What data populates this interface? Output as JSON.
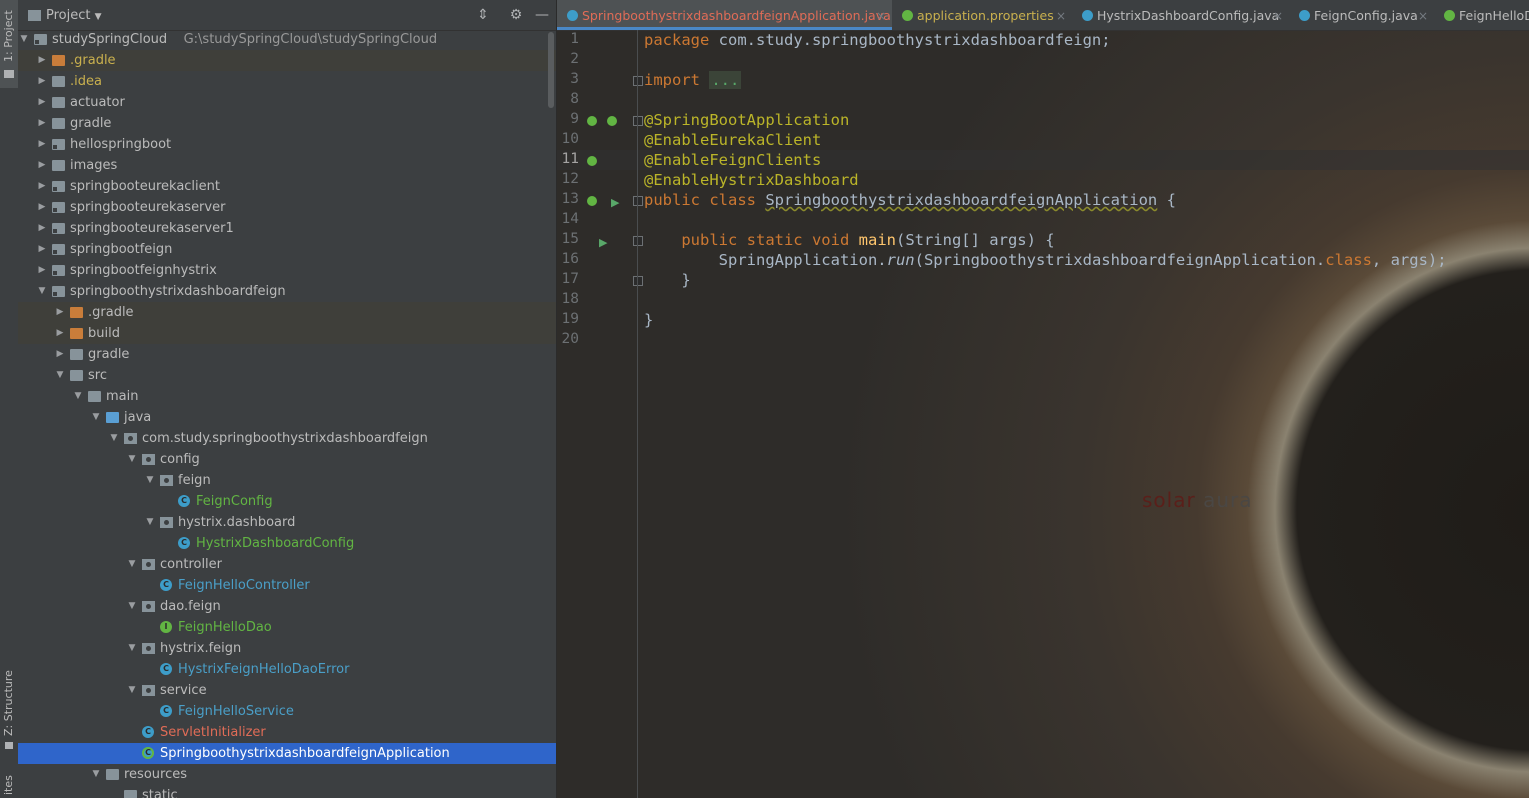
{
  "left_stripe": {
    "project_tab": "1: Project",
    "structure_tab": "Z: Structure",
    "favorites_tab": "ites"
  },
  "project_panel": {
    "title": "Project"
  },
  "tree": [
    {
      "label": "studySpringCloud",
      "path": "G:\\studySpringCloud\\studySpringCloud",
      "indent": 0,
      "arrow": "open",
      "icon": "module",
      "color": ""
    },
    {
      "label": ".gradle",
      "indent": 1,
      "arrow": "closed",
      "icon": "folder-orange",
      "color": "yellow",
      "hl": true
    },
    {
      "label": ".idea",
      "indent": 1,
      "arrow": "closed",
      "icon": "folder",
      "color": "yellow"
    },
    {
      "label": "actuator",
      "indent": 1,
      "arrow": "closed",
      "icon": "folder",
      "color": ""
    },
    {
      "label": "gradle",
      "indent": 1,
      "arrow": "closed",
      "icon": "folder",
      "color": ""
    },
    {
      "label": "hellospringboot",
      "indent": 1,
      "arrow": "closed",
      "icon": "module",
      "color": ""
    },
    {
      "label": "images",
      "indent": 1,
      "arrow": "closed",
      "icon": "folder",
      "color": ""
    },
    {
      "label": "springbooteurekaclient",
      "indent": 1,
      "arrow": "closed",
      "icon": "module",
      "color": ""
    },
    {
      "label": "springbooteurekaserver",
      "indent": 1,
      "arrow": "closed",
      "icon": "module",
      "color": ""
    },
    {
      "label": "springbooteurekaserver1",
      "indent": 1,
      "arrow": "closed",
      "icon": "module",
      "color": ""
    },
    {
      "label": "springbootfeign",
      "indent": 1,
      "arrow": "closed",
      "icon": "module",
      "color": ""
    },
    {
      "label": "springbootfeignhystrix",
      "indent": 1,
      "arrow": "closed",
      "icon": "module",
      "color": ""
    },
    {
      "label": "springboothystrixdashboardfeign",
      "indent": 1,
      "arrow": "open",
      "icon": "module",
      "color": ""
    },
    {
      "label": ".gradle",
      "indent": 2,
      "arrow": "closed",
      "icon": "folder-orange",
      "color": "",
      "hl": true
    },
    {
      "label": "build",
      "indent": 2,
      "arrow": "closed",
      "icon": "folder-orange",
      "color": "",
      "hl": true
    },
    {
      "label": "gradle",
      "indent": 2,
      "arrow": "closed",
      "icon": "folder",
      "color": ""
    },
    {
      "label": "src",
      "indent": 2,
      "arrow": "open",
      "icon": "folder",
      "color": ""
    },
    {
      "label": "main",
      "indent": 3,
      "arrow": "open",
      "icon": "folder",
      "color": ""
    },
    {
      "label": "java",
      "indent": 4,
      "arrow": "open",
      "icon": "folder-blue",
      "color": ""
    },
    {
      "label": "com.study.springboothystrixdashboardfeign",
      "indent": 5,
      "arrow": "open",
      "icon": "pkg",
      "color": ""
    },
    {
      "label": "config",
      "indent": 6,
      "arrow": "open",
      "icon": "pkg",
      "color": ""
    },
    {
      "label": "feign",
      "indent": 7,
      "arrow": "open",
      "icon": "pkg",
      "color": ""
    },
    {
      "label": "FeignConfig",
      "indent": 8,
      "arrow": "",
      "icon": "cls",
      "color": "green"
    },
    {
      "label": "hystrix.dashboard",
      "indent": 7,
      "arrow": "open",
      "icon": "pkg",
      "color": ""
    },
    {
      "label": "HystrixDashboardConfig",
      "indent": 8,
      "arrow": "",
      "icon": "cls",
      "color": "green"
    },
    {
      "label": "controller",
      "indent": 6,
      "arrow": "open",
      "icon": "pkg",
      "color": ""
    },
    {
      "label": "FeignHelloController",
      "indent": 7,
      "arrow": "",
      "icon": "cls",
      "color": "blue2"
    },
    {
      "label": "dao.feign",
      "indent": 6,
      "arrow": "open",
      "icon": "pkg",
      "color": ""
    },
    {
      "label": "FeignHelloDao",
      "indent": 7,
      "arrow": "",
      "icon": "itf",
      "color": "green"
    },
    {
      "label": "hystrix.feign",
      "indent": 6,
      "arrow": "open",
      "icon": "pkg",
      "color": ""
    },
    {
      "label": "HystrixFeignHelloDaoError",
      "indent": 7,
      "arrow": "",
      "icon": "cls",
      "color": "blue2"
    },
    {
      "label": "service",
      "indent": 6,
      "arrow": "open",
      "icon": "pkg",
      "color": ""
    },
    {
      "label": "FeignHelloService",
      "indent": 7,
      "arrow": "",
      "icon": "cls",
      "color": "blue2"
    },
    {
      "label": "ServletInitializer",
      "indent": 6,
      "arrow": "",
      "icon": "cls",
      "color": "red"
    },
    {
      "label": "SpringboothystrixdashboardfeignApplication",
      "indent": 6,
      "arrow": "",
      "icon": "spring",
      "color": "",
      "sel": true
    },
    {
      "label": "resources",
      "indent": 4,
      "arrow": "open",
      "icon": "folder",
      "color": ""
    },
    {
      "label": "static",
      "indent": 5,
      "arrow": "",
      "icon": "folder",
      "color": ""
    }
  ],
  "tabs": [
    {
      "label": "SpringboothystrixdashboardfeignApplication.java",
      "icon": "spring",
      "active": true,
      "color": "#e06c57"
    },
    {
      "label": "application.properties",
      "icon": "prop",
      "active": false,
      "color": "#c9b04e"
    },
    {
      "label": "HystrixDashboardConfig.java",
      "icon": "cls",
      "active": false,
      "color": "#bbbbbb"
    },
    {
      "label": "FeignConfig.java",
      "icon": "cls",
      "active": false,
      "color": "#bbbbbb"
    },
    {
      "label": "FeignHelloD",
      "icon": "itf",
      "active": false,
      "color": "#bbbbbb"
    }
  ],
  "line_numbers": [
    "1",
    "2",
    "3",
    "8",
    "9",
    "10",
    "11",
    "12",
    "13",
    "14",
    "15",
    "16",
    "17",
    "18",
    "19",
    "20"
  ],
  "current_line": "11",
  "code": {
    "l1_kw": "package",
    "l1_rest": " com.study.springboothystrixdashboardfeign;",
    "l3_kw": "import",
    "l3_fold": "...",
    "l9": "@SpringBootApplication",
    "l10": "@EnableEurekaClient",
    "l11": "@EnableFeignClients",
    "l12": "@EnableHystrixDashboard",
    "l13_kw": "public class",
    "l13_name": "SpringboothystrixdashboardfeignApplication",
    "l13_end": " {",
    "l15_kw": "public static void",
    "l15_fn": "main",
    "l15_rest": "(String[] args) {",
    "l16_a": "SpringApplication.",
    "l16_run": "run",
    "l16_b": "(SpringboothystrixdashboardfeignApplication.",
    "l16_class": "class",
    "l16_c": ", args);",
    "l17": "}",
    "l19": "}"
  },
  "watermark": {
    "part1": "solar",
    "part2": "aura"
  }
}
